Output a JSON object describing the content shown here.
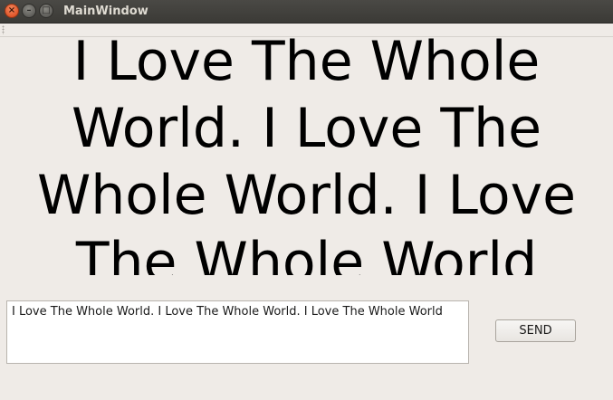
{
  "window": {
    "title": "MainWindow",
    "close_glyph": "×",
    "minimize_glyph": "–",
    "maximize_glyph": "□"
  },
  "display_label": {
    "text": "I Love The Whole World. I Love The Whole World. I Love The Whole World"
  },
  "input": {
    "value": "I Love The Whole World. I Love The Whole World. I Love The Whole World"
  },
  "send_button": {
    "label": "SEND"
  },
  "icons": {
    "close": "close-icon",
    "minimize": "minimize-icon",
    "maximize": "maximize-icon"
  },
  "colors": {
    "window_bg": "#efebe7",
    "titlebar_bg": "#3b3a36",
    "close_button": "#e0562a",
    "title_text": "#dfdbd2"
  }
}
